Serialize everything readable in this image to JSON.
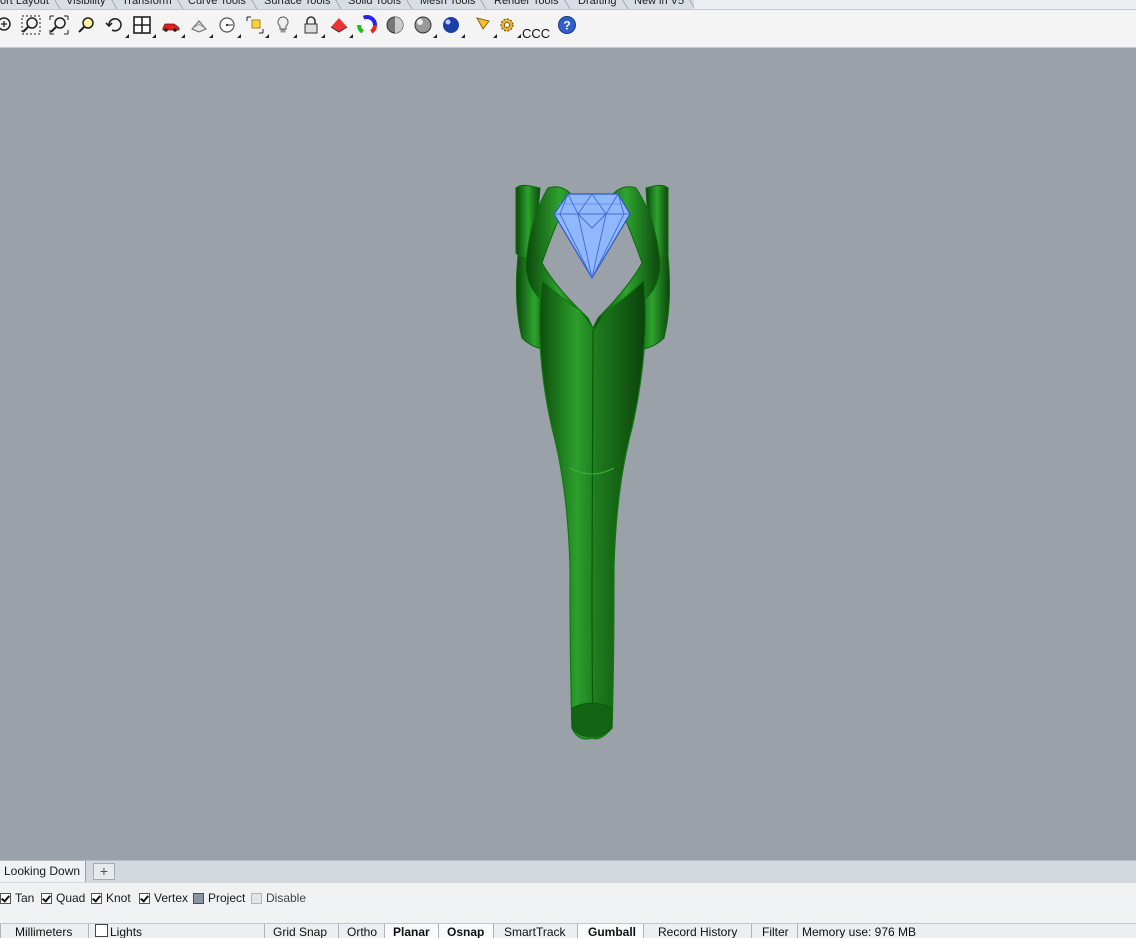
{
  "toolbar_tabs": [
    "ort Layout",
    "Visibility",
    "Transform",
    "Curve Tools",
    "Surface Tools",
    "Solid Tools",
    "Mesh Tools",
    "Render Tools",
    "Drafting",
    "New in V5"
  ],
  "toolbar": {
    "ccc_label": "CCC",
    "icons": [
      "zoom-extents-icon",
      "zoom-window-icon",
      "zoom-selected-icon",
      "zoom-target-icon",
      "undo-view-icon",
      "four-viewports-icon",
      "car-icon",
      "pan-icon",
      "circle-center-icon",
      "select-points-icon",
      "lightbulb-icon",
      "lock-icon",
      "layer-icon",
      "color-wheel-icon",
      "shade-sphere-icon",
      "render-sphere-icon",
      "blue-sphere-icon",
      "flag-icon",
      "gear-icon",
      "help-icon"
    ]
  },
  "viewport": {
    "tab_label": "Looking Down",
    "add_tab_label": "+"
  },
  "osnap": {
    "items": [
      {
        "label": "Tan",
        "state": "checked"
      },
      {
        "label": "Quad",
        "state": "checked"
      },
      {
        "label": "Knot",
        "state": "checked"
      },
      {
        "label": "Vertex",
        "state": "checked"
      },
      {
        "label": "Project",
        "state": "filled"
      },
      {
        "label": "Disable",
        "state": "disabled"
      }
    ]
  },
  "status_bar": {
    "units": "Millimeters",
    "lights": "Lights",
    "grid_snap": "Grid Snap",
    "ortho": "Ortho",
    "planar": "Planar",
    "osnap": "Osnap",
    "smarttrack": "SmartTrack",
    "gumball": "Gumball",
    "record_history": "Record History",
    "filter": "Filter",
    "memory": "Memory use: 976 MB"
  },
  "colors": {
    "viewport_bg": "#9ba1a8",
    "ring_green": "#1f8a1f",
    "gem_blue": "#8fb8ff"
  }
}
